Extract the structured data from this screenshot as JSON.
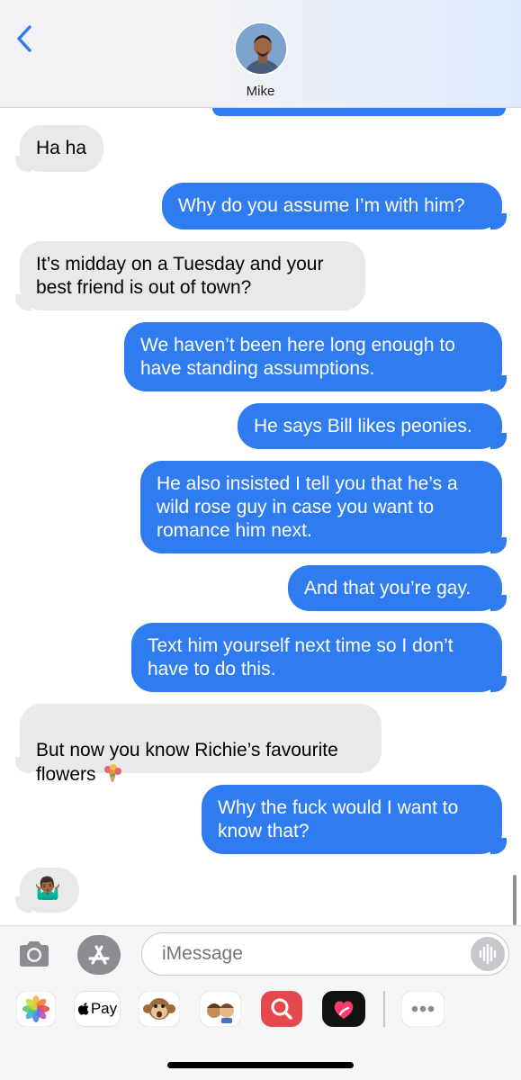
{
  "header": {
    "contact_name": "Mike"
  },
  "messages": [
    {
      "side": "received",
      "text": "Ha ha"
    },
    {
      "side": "sent",
      "text": "Why do you assume I’m with him?"
    },
    {
      "side": "received",
      "text": "It’s midday on a Tuesday and your\nbest friend is out of town?"
    },
    {
      "side": "sent",
      "text": "We haven’t been here long enough to\nhave standing assumptions."
    },
    {
      "side": "sent",
      "text": "He says Bill likes peonies."
    },
    {
      "side": "sent",
      "text": "He also insisted I tell you that he’s a\nwild rose guy in case you want to\nromance him next."
    },
    {
      "side": "sent",
      "text": "And that you’re gay."
    },
    {
      "side": "sent",
      "text": "Text him yourself next time so I don’t\nhave to do this."
    },
    {
      "side": "received",
      "text": "But now you know Richie’s favourite\nflowers"
    },
    {
      "side": "sent",
      "text": "Why the fuck would I want to\nknow that?"
    },
    {
      "side": "received",
      "text": "🤷🏾‍♂️"
    }
  ],
  "input": {
    "placeholder": "iMessage"
  },
  "apps": {
    "apple_pay_label": "Pay"
  },
  "colors": {
    "sent_bubble": "#2f7bf0",
    "received_bubble": "#e9e9eb",
    "accent": "#2f7bf0"
  },
  "icons": [
    "chevron-left-icon",
    "camera-icon",
    "app-store-icon",
    "audio-waveform-icon",
    "photos-icon",
    "apple-pay-icon",
    "monkey-memoji-icon",
    "memoji-stickers-icon",
    "image-search-icon",
    "digital-touch-icon",
    "more-icon"
  ]
}
